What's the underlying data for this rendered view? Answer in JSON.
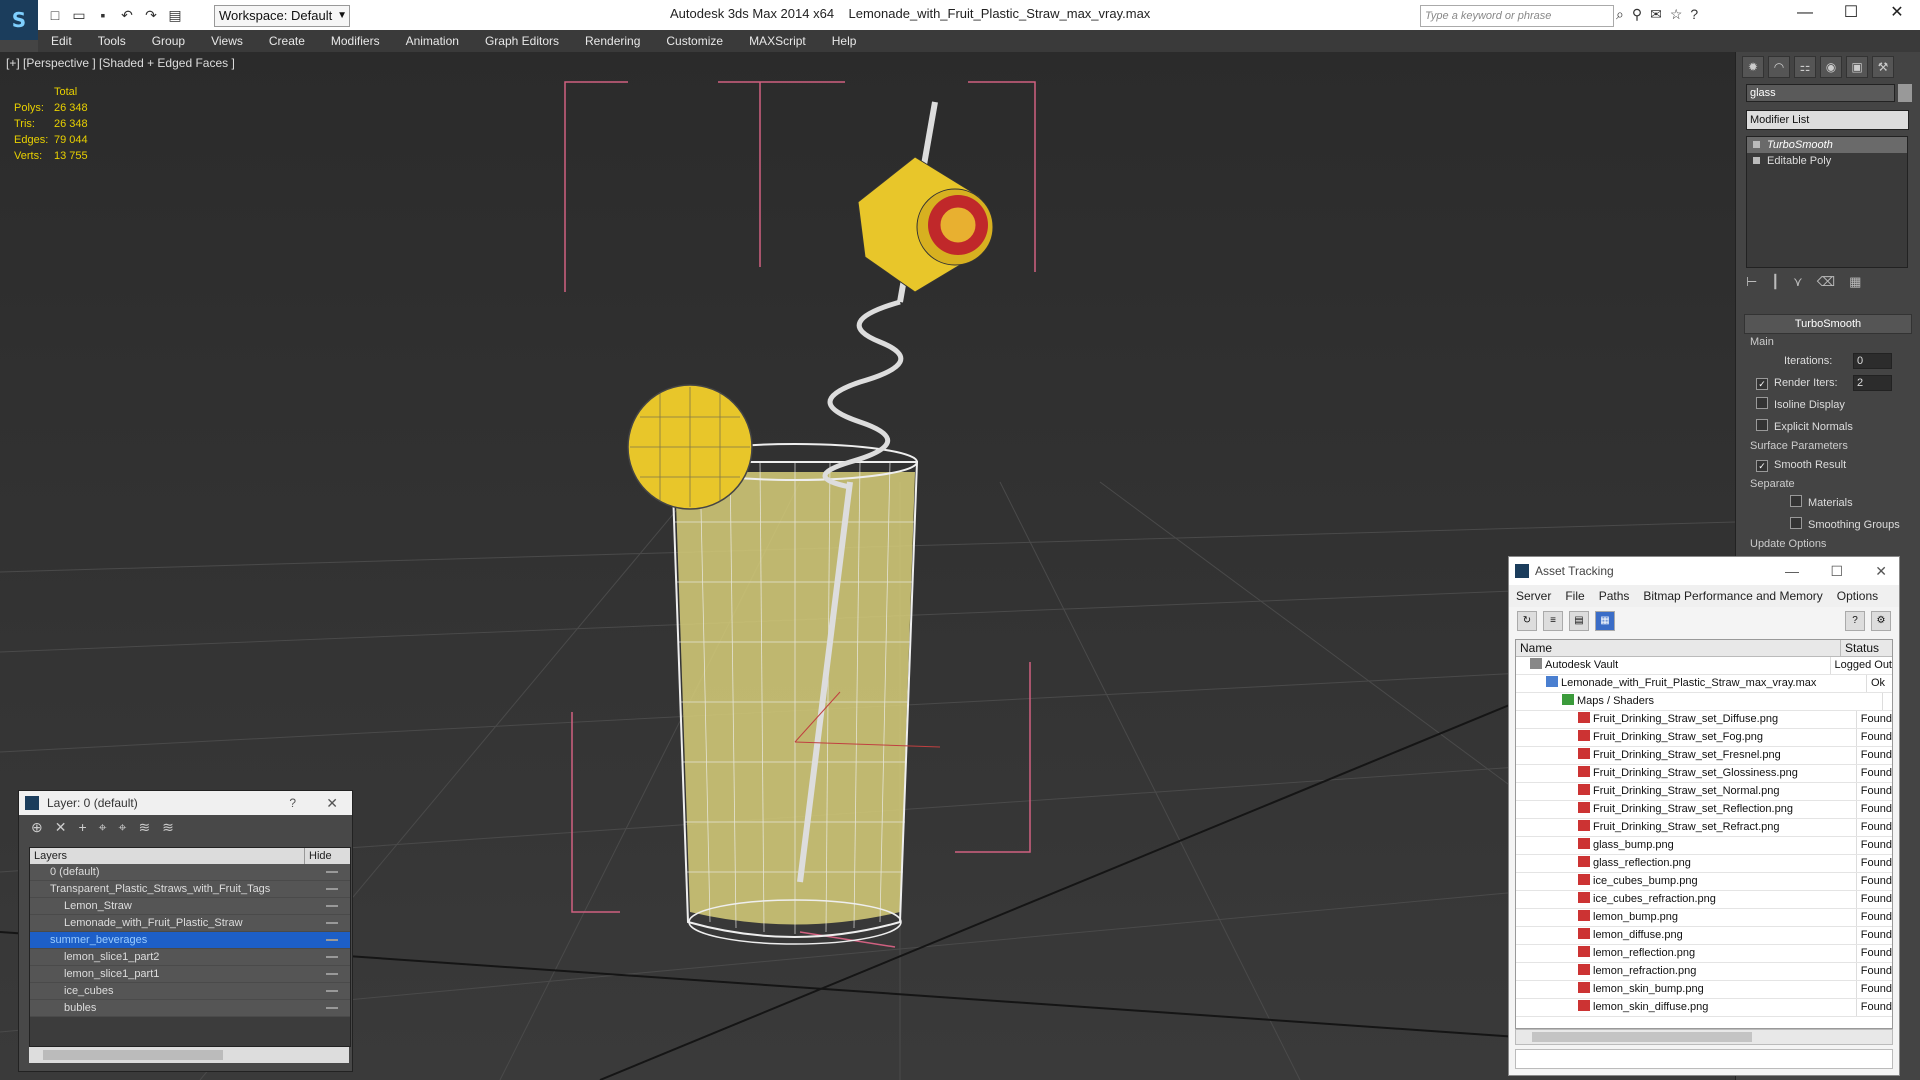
{
  "titlebar": {
    "app_title": "Autodesk 3ds Max  2014 x64",
    "file_title": "Lemonade_with_Fruit_Plastic_Straw_max_vray.max",
    "workspace": "Workspace: Default",
    "search_placeholder": "Type a keyword or phrase"
  },
  "menu": [
    "Edit",
    "Tools",
    "Group",
    "Views",
    "Create",
    "Modifiers",
    "Animation",
    "Graph Editors",
    "Rendering",
    "Customize",
    "MAXScript",
    "Help"
  ],
  "viewport": {
    "label": "[+] [Perspective ] [Shaded + Edged Faces ]",
    "stats": {
      "header": "Total",
      "rows": [
        {
          "k": "Polys:",
          "v": "26 348"
        },
        {
          "k": "Tris:",
          "v": "26 348"
        },
        {
          "k": "Edges:",
          "v": "79 044"
        },
        {
          "k": "Verts:",
          "v": "13 755"
        }
      ]
    }
  },
  "command_panel": {
    "object_name": "glass",
    "modifier_list": "Modifier List",
    "stack": [
      "TurboSmooth",
      "Editable Poly"
    ],
    "rollout_title": "TurboSmooth",
    "main_group": "Main",
    "iterations_label": "Iterations:",
    "iterations_value": "0",
    "render_iters_label": "Render Iters:",
    "render_iters_value": "2",
    "isoline": "Isoline Display",
    "explicit_normals": "Explicit Normals",
    "surface_params": "Surface Parameters",
    "smooth_result": "Smooth Result",
    "separate": "Separate",
    "materials": "Materials",
    "smoothing_groups": "Smoothing Groups",
    "update_options": "Update Options"
  },
  "layer_window": {
    "title": "Layer: 0 (default)",
    "question": "?",
    "col_layers": "Layers",
    "col_hide": "Hide",
    "rows": [
      {
        "label": "0 (default)",
        "child": false,
        "sel": false
      },
      {
        "label": "Transparent_Plastic_Straws_with_Fruit_Tags",
        "child": false,
        "sel": false
      },
      {
        "label": "Lemon_Straw",
        "child": true,
        "sel": false
      },
      {
        "label": "Lemonade_with_Fruit_Plastic_Straw",
        "child": true,
        "sel": false
      },
      {
        "label": "summer_beverages",
        "child": false,
        "sel": true
      },
      {
        "label": "lemon_slice1_part2",
        "child": true,
        "sel": false
      },
      {
        "label": "lemon_slice1_part1",
        "child": true,
        "sel": false
      },
      {
        "label": "ice_cubes",
        "child": true,
        "sel": false
      },
      {
        "label": "bubles",
        "child": true,
        "sel": false
      }
    ]
  },
  "asset_window": {
    "title": "Asset Tracking",
    "menu": [
      "Server",
      "File",
      "Paths",
      "Bitmap Performance and Memory",
      "Options"
    ],
    "col_name": "Name",
    "col_status": "Status",
    "rows": [
      {
        "name": "Autodesk Vault",
        "status": "Logged Out",
        "indent": 14,
        "icon": "vault"
      },
      {
        "name": "Lemonade_with_Fruit_Plastic_Straw_max_vray.max",
        "status": "Ok",
        "indent": 30,
        "icon": "max"
      },
      {
        "name": "Maps / Shaders",
        "status": "",
        "indent": 46,
        "icon": "folder"
      },
      {
        "name": "Fruit_Drinking_Straw_set_Diffuse.png",
        "status": "Found",
        "indent": 62,
        "icon": "png"
      },
      {
        "name": "Fruit_Drinking_Straw_set_Fog.png",
        "status": "Found",
        "indent": 62,
        "icon": "png"
      },
      {
        "name": "Fruit_Drinking_Straw_set_Fresnel.png",
        "status": "Found",
        "indent": 62,
        "icon": "png"
      },
      {
        "name": "Fruit_Drinking_Straw_set_Glossiness.png",
        "status": "Found",
        "indent": 62,
        "icon": "png"
      },
      {
        "name": "Fruit_Drinking_Straw_set_Normal.png",
        "status": "Found",
        "indent": 62,
        "icon": "png"
      },
      {
        "name": "Fruit_Drinking_Straw_set_Reflection.png",
        "status": "Found",
        "indent": 62,
        "icon": "png"
      },
      {
        "name": "Fruit_Drinking_Straw_set_Refract.png",
        "status": "Found",
        "indent": 62,
        "icon": "png"
      },
      {
        "name": "glass_bump.png",
        "status": "Found",
        "indent": 62,
        "icon": "png"
      },
      {
        "name": "glass_reflection.png",
        "status": "Found",
        "indent": 62,
        "icon": "png"
      },
      {
        "name": "ice_cubes_bump.png",
        "status": "Found",
        "indent": 62,
        "icon": "png"
      },
      {
        "name": "ice_cubes_refraction.png",
        "status": "Found",
        "indent": 62,
        "icon": "png"
      },
      {
        "name": "lemon_bump.png",
        "status": "Found",
        "indent": 62,
        "icon": "png"
      },
      {
        "name": "lemon_diffuse.png",
        "status": "Found",
        "indent": 62,
        "icon": "png"
      },
      {
        "name": "lemon_reflection.png",
        "status": "Found",
        "indent": 62,
        "icon": "png"
      },
      {
        "name": "lemon_refraction.png",
        "status": "Found",
        "indent": 62,
        "icon": "png"
      },
      {
        "name": "lemon_skin_bump.png",
        "status": "Found",
        "indent": 62,
        "icon": "png"
      },
      {
        "name": "lemon_skin_diffuse.png",
        "status": "Found",
        "indent": 62,
        "icon": "png"
      }
    ]
  },
  "colors": {
    "viewport_bg": "#2a2a2a",
    "stats_text": "#e8d000",
    "selection": "#1d5fc8",
    "liquid": "#d8cf7a",
    "lemon": "#e8c62a"
  }
}
